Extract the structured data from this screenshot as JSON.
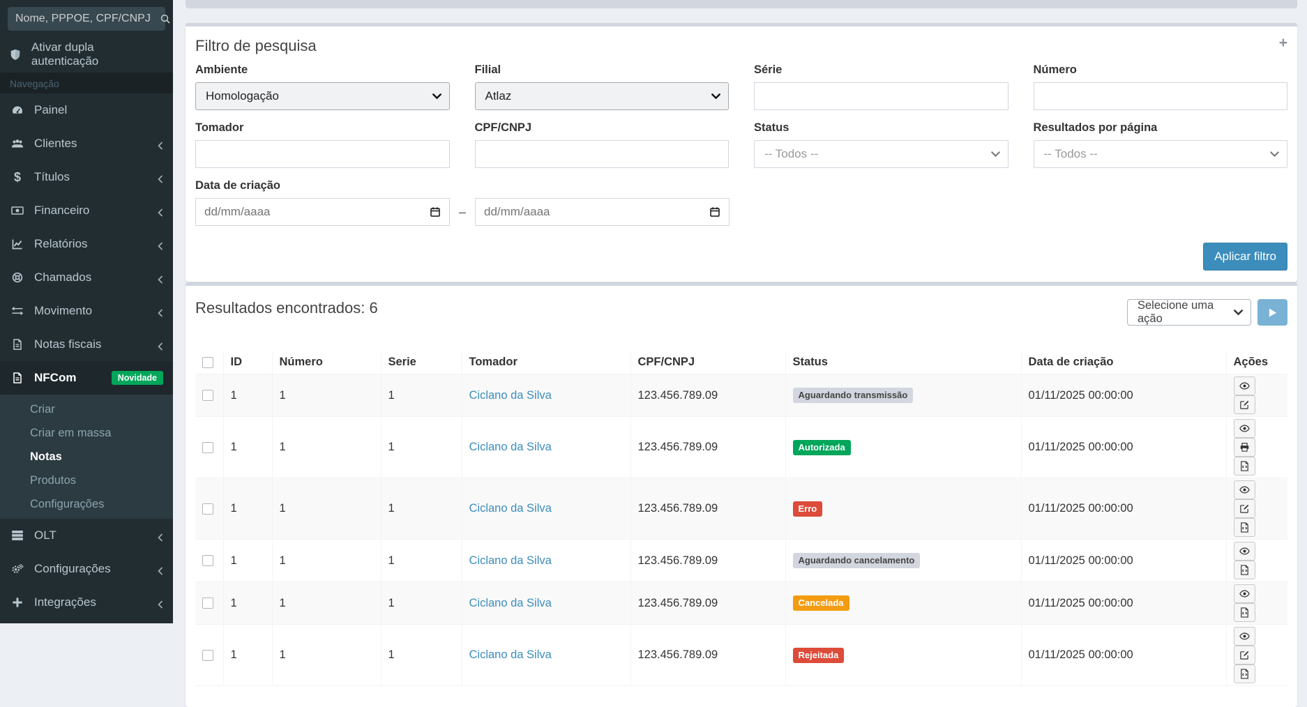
{
  "colors": {
    "sidebar_bg": "#222d32",
    "sidebar_active_bg": "#1e282c",
    "submenu_bg": "#2c3b41",
    "body_bg": "#ecf0f5",
    "panel_border": "#d2d6de",
    "primary": "#3c8dbc",
    "badge_green": "#00a65a",
    "badge_red": "#dd4b39",
    "badge_orange": "#f39c12",
    "badge_gray": "#d2d6de",
    "link": "#3c8dbc"
  },
  "icons": {
    "search-icon": "🔍",
    "shield-icon": "🛡",
    "gauge-icon": "◔",
    "users-icon": "👥",
    "dollar-icon": "$",
    "money-icon": "▭",
    "chart-line-icon": "📈",
    "life-ring-icon": "◎",
    "exchange-icon": "⇄",
    "file-lines-icon": "🗎",
    "server-icon": "☰",
    "gears-icon": "⚙",
    "plus-icon": "+",
    "angle-left-icon": "‹",
    "calendar-icon": "▦",
    "eye-icon": "👁",
    "edit-icon": "✎",
    "print-icon": "🖨",
    "file-code-icon": "🗎",
    "play-icon": "▶",
    "collapse-plus-icon": "+"
  },
  "sidebar": {
    "search_placeholder": "Nome, PPPOE, CPF/CNPJ",
    "two_factor_label": "Ativar dupla autenticação",
    "section_header": "Navegação",
    "items": [
      {
        "label": "Painel"
      },
      {
        "label": "Clientes"
      },
      {
        "label": "Títulos"
      },
      {
        "label": "Financeiro"
      },
      {
        "label": "Relatórios"
      },
      {
        "label": "Chamados"
      },
      {
        "label": "Movimento"
      },
      {
        "label": "Notas fiscais"
      },
      {
        "label": "NFCom",
        "badge": "Novidade"
      },
      {
        "label": "OLT"
      },
      {
        "label": "Configurações"
      },
      {
        "label": "Integrações"
      }
    ],
    "nfcom_submenu": [
      {
        "label": "Criar"
      },
      {
        "label": "Criar em massa"
      },
      {
        "label": "Notas",
        "active": true
      },
      {
        "label": "Produtos"
      },
      {
        "label": "Configurações"
      }
    ]
  },
  "filter": {
    "title": "Filtro de pesquisa",
    "collapse_label": "+",
    "ambiente_label": "Ambiente",
    "ambiente_value": "Homologação",
    "filial_label": "Filial",
    "filial_value": "Atlaz",
    "serie_label": "Série",
    "serie_value": "",
    "numero_label": "Número",
    "numero_value": "",
    "tomador_label": "Tomador",
    "tomador_value": "",
    "cpf_label": "CPF/CNPJ",
    "cpf_value": "",
    "status_label": "Status",
    "status_value": "-- Todos --",
    "per_page_label": "Resultados por página",
    "per_page_value": "-- Todos --",
    "date_label": "Data de criação",
    "date_placeholder": "dd/mm/aaaa",
    "date_separator": "–",
    "apply_label": "Aplicar filtro"
  },
  "results": {
    "title": "Resultados encontrados: 6",
    "action_select_value": "Selecione uma ação",
    "columns": [
      "ID",
      "Número",
      "Serie",
      "Tomador",
      "CPF/CNPJ",
      "Status",
      "Data de criação",
      "Ações"
    ],
    "rows": [
      {
        "id": "1",
        "numero": "1",
        "serie": "1",
        "tomador": "Ciclano da Silva",
        "cpf": "123.456.789.09",
        "status": "Aguardando transmissão",
        "status_type": "gray",
        "created": "01/11/2025 00:00:00",
        "actions": [
          "view",
          "edit"
        ]
      },
      {
        "id": "1",
        "numero": "1",
        "serie": "1",
        "tomador": "Ciclano da Silva",
        "cpf": "123.456.789.09",
        "status": "Autorizada",
        "status_type": "green",
        "created": "01/11/2025 00:00:00",
        "actions": [
          "view",
          "print",
          "xml"
        ]
      },
      {
        "id": "1",
        "numero": "1",
        "serie": "1",
        "tomador": "Ciclano da Silva",
        "cpf": "123.456.789.09",
        "status": "Erro",
        "status_type": "red",
        "created": "01/11/2025 00:00:00",
        "actions": [
          "view",
          "edit",
          "xml"
        ]
      },
      {
        "id": "1",
        "numero": "1",
        "serie": "1",
        "tomador": "Ciclano da Silva",
        "cpf": "123.456.789.09",
        "status": "Aguardando cancelamento",
        "status_type": "gray",
        "created": "01/11/2025 00:00:00",
        "actions": [
          "view",
          "xml"
        ]
      },
      {
        "id": "1",
        "numero": "1",
        "serie": "1",
        "tomador": "Ciclano da Silva",
        "cpf": "123.456.789.09",
        "status": "Cancelada",
        "status_type": "orange",
        "created": "01/11/2025 00:00:00",
        "actions": [
          "view",
          "xml"
        ]
      },
      {
        "id": "1",
        "numero": "1",
        "serie": "1",
        "tomador": "Ciclano da Silva",
        "cpf": "123.456.789.09",
        "status": "Rejeitada",
        "status_type": "red",
        "created": "01/11/2025 00:00:00",
        "actions": [
          "view",
          "edit",
          "xml"
        ]
      }
    ]
  }
}
